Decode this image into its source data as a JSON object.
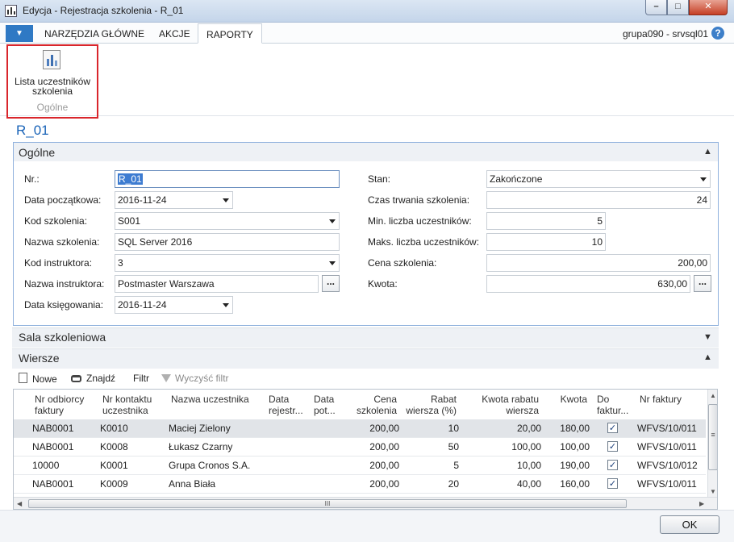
{
  "window": {
    "title": "Edycja - Rejestracja szkolenia - R_01",
    "min": "–",
    "max": "□",
    "close": "✕"
  },
  "ribbon": {
    "menu_glyph": "▼",
    "tabs": [
      "NARZĘDZIA GŁÓWNE",
      "AKCJE",
      "RAPORTY"
    ],
    "active_tab": "RAPORTY",
    "server": "grupa090 - srvsql01",
    "help": "?",
    "report_button": {
      "label": "Lista uczestników szkolenia",
      "icon": "report-chart-icon"
    },
    "group_label": "Ogólne"
  },
  "record": {
    "title": "R_01"
  },
  "general": {
    "header": "Ogólne",
    "fields": {
      "nr": {
        "label": "Nr.:",
        "value": "R_01"
      },
      "start_date": {
        "label": "Data początkowa:",
        "value": "2016-11-24"
      },
      "course_code": {
        "label": "Kod szkolenia:",
        "value": "S001"
      },
      "course_name": {
        "label": "Nazwa szkolenia:",
        "value": "SQL Server 2016"
      },
      "instructor_code": {
        "label": "Kod instruktora:",
        "value": "3"
      },
      "instructor_name": {
        "label": "Nazwa instruktora:",
        "value": "Postmaster Warszawa"
      },
      "posting_date": {
        "label": "Data księgowania:",
        "value": "2016-11-24"
      },
      "status": {
        "label": "Stan:",
        "value": "Zakończone"
      },
      "duration": {
        "label": "Czas trwania szkolenia:",
        "value": "24"
      },
      "min_participants": {
        "label": "Min. liczba uczestników:",
        "value": "5"
      },
      "max_participants": {
        "label": "Maks. liczba uczestników:",
        "value": "10"
      },
      "price": {
        "label": "Cena szkolenia:",
        "value": "200,00"
      },
      "amount": {
        "label": "Kwota:",
        "value": "630,00"
      }
    },
    "assist_glyph": "..."
  },
  "room": {
    "header": "Sala szkoleniowa"
  },
  "lines": {
    "header": "Wiersze",
    "toolbar": {
      "new": "Nowe",
      "find": "Znajdź",
      "filter": "Filtr",
      "clear_filter": "Wyczyść filtr"
    },
    "columns": [
      [
        "Nr odbiorcy",
        "faktury"
      ],
      [
        "Nr kontaktu",
        "uczestnika"
      ],
      [
        "Nazwa uczestnika",
        ""
      ],
      [
        "Data",
        "rejestr..."
      ],
      [
        "Data",
        "pot..."
      ],
      [
        "Cena",
        "szkolenia"
      ],
      [
        "Rabat",
        "wiersza (%)"
      ],
      [
        "Kwota rabatu",
        "wiersza"
      ],
      [
        "Kwota",
        ""
      ],
      [
        "Do",
        "faktur..."
      ],
      [
        "Nr faktury",
        ""
      ]
    ],
    "rows": [
      {
        "bill_to": "NAB0001",
        "contact": "K0010",
        "name": "Maciej Zielony",
        "reg": "",
        "conf": "",
        "price": "200,00",
        "disc": "10",
        "disc_amt": "20,00",
        "amount": "180,00",
        "invoice": true,
        "inv_no": "WFVS/10/011"
      },
      {
        "bill_to": "NAB0001",
        "contact": "K0008",
        "name": "Łukasz Czarny",
        "reg": "",
        "conf": "",
        "price": "200,00",
        "disc": "50",
        "disc_amt": "100,00",
        "amount": "100,00",
        "invoice": true,
        "inv_no": "WFVS/10/011"
      },
      {
        "bill_to": "10000",
        "contact": "K0001",
        "name": "Grupa Cronos S.A.",
        "reg": "",
        "conf": "",
        "price": "200,00",
        "disc": "5",
        "disc_amt": "10,00",
        "amount": "190,00",
        "invoice": true,
        "inv_no": "WFVS/10/012"
      },
      {
        "bill_to": "NAB0001",
        "contact": "K0009",
        "name": "Anna Biała",
        "reg": "",
        "conf": "",
        "price": "200,00",
        "disc": "20",
        "disc_amt": "40,00",
        "amount": "160,00",
        "invoice": true,
        "inv_no": "WFVS/10/011"
      }
    ],
    "check_glyph": "✓",
    "hscroll_grip": "III",
    "vscroll_grip": "≡"
  },
  "footer": {
    "ok": "OK"
  }
}
